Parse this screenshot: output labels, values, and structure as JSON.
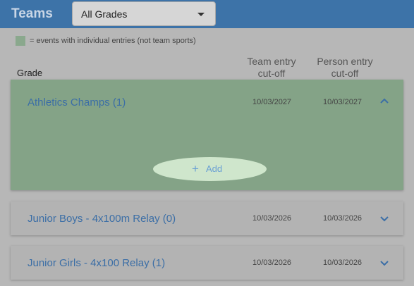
{
  "header": {
    "title": "Teams",
    "grade_filter": {
      "selected": "All Grades"
    }
  },
  "legend": {
    "text": "= events with individual entries (not team sports)",
    "swatch_color": "#8aa88d"
  },
  "table": {
    "col_grade": "Grade",
    "col_team_cutoff": [
      "Team entry",
      "cut-off"
    ],
    "col_person_cutoff": [
      "Person entry",
      "cut-off"
    ]
  },
  "teams": [
    {
      "name": "Athletics Champs (1)",
      "team_cutoff": "10/03/2027",
      "person_cutoff": "10/03/2027",
      "expanded": true,
      "add_label": "Add"
    },
    {
      "name": "Junior Boys - 4x100m Relay (0)",
      "team_cutoff": "10/03/2026",
      "person_cutoff": "10/03/2026",
      "expanded": false
    },
    {
      "name": "Junior Girls - 4x100 Relay (1)",
      "team_cutoff": "10/03/2026",
      "person_cutoff": "10/03/2026",
      "expanded": false
    }
  ],
  "colors": {
    "topbar": "#3d73a8",
    "link": "#3b6ea6",
    "expanded_card": "#84a387"
  },
  "icons": {
    "collapse": "chevron-up-icon",
    "expand": "chevron-down-icon",
    "add": "plus-icon"
  }
}
